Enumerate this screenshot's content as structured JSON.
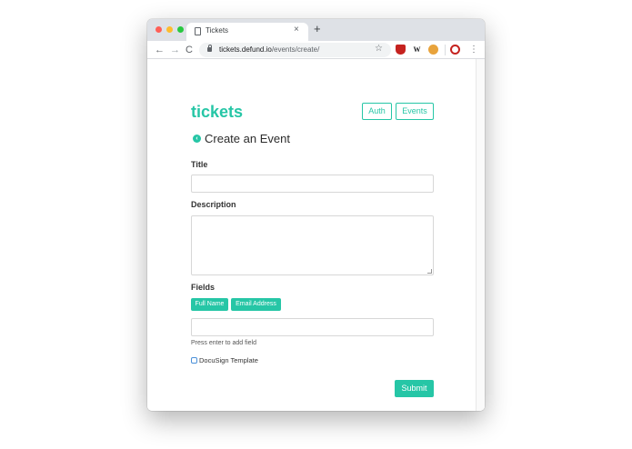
{
  "browser": {
    "tab_title": "Tickets",
    "tab_close": "×",
    "new_tab": "+",
    "url_host": "tickets.defund.io",
    "url_path": "/events/create/",
    "nav_back": "←",
    "nav_forward": "→",
    "nav_reload": "C",
    "star": "☆",
    "extensions": [
      {
        "icon": "shield-icon",
        "text": ""
      },
      {
        "icon": "wikipedia-icon",
        "text": "W"
      },
      {
        "icon": "cookie-icon",
        "text": ""
      },
      {
        "icon": "spiral-icon",
        "text": ""
      }
    ],
    "menu": "⋮"
  },
  "header": {
    "brand": "tickets",
    "auth_label": "Auth",
    "events_label": "Events"
  },
  "page": {
    "back_glyph": "‹",
    "title": "Create an Event"
  },
  "form": {
    "title_label": "Title",
    "title_value": "",
    "description_label": "Description",
    "description_value": "",
    "fields_label": "Fields",
    "fields": [
      "Full Name",
      "Email Address"
    ],
    "field_input_value": "",
    "hint": "Press enter to add field",
    "docusign_label": "DocuSign Template",
    "docusign_checked": false,
    "submit_label": "Submit"
  },
  "colors": {
    "accent": "#26c6a6",
    "tabstrip": "#dee1e6"
  }
}
